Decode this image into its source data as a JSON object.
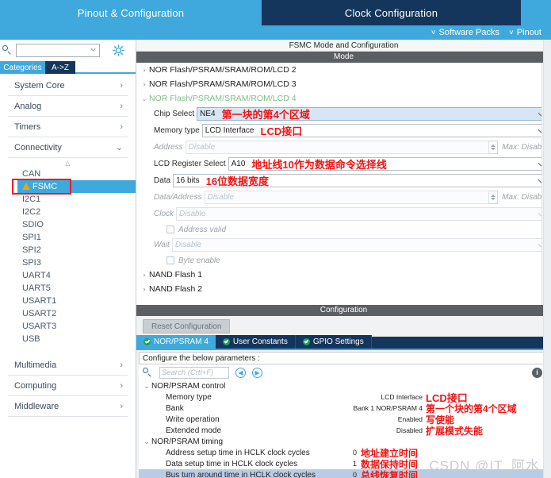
{
  "topbar": {
    "tabs": [
      {
        "label": "Pinout & Configuration",
        "state": "active"
      },
      {
        "label": "Clock Configuration",
        "state": "inactive"
      }
    ]
  },
  "secondbar": {
    "items": [
      {
        "label": "Software Packs",
        "icon": "chevron-down-icon"
      },
      {
        "label": "Pinout",
        "icon": "chevron-down-icon"
      }
    ]
  },
  "sidebar": {
    "search": {
      "value": "",
      "placeholder": ""
    },
    "gear_icon": "gear-icon",
    "tabs": [
      {
        "label": "Categories",
        "selected": true
      },
      {
        "label": "A->Z",
        "selected": false
      }
    ],
    "categories": [
      {
        "label": "System Core",
        "expanded": false
      },
      {
        "label": "Analog",
        "expanded": false
      },
      {
        "label": "Timers",
        "expanded": false
      },
      {
        "label": "Connectivity",
        "expanded": true
      }
    ],
    "peripherals": [
      {
        "label": "CAN",
        "selected": false,
        "warning": false
      },
      {
        "label": "FSMC",
        "selected": true,
        "warning": true
      },
      {
        "label": "I2C1",
        "selected": false,
        "warning": false
      },
      {
        "label": "I2C2",
        "selected": false,
        "warning": false
      },
      {
        "label": "SDIO",
        "selected": false,
        "warning": false
      },
      {
        "label": "SPI1",
        "selected": false,
        "warning": false
      },
      {
        "label": "SPI2",
        "selected": false,
        "warning": false
      },
      {
        "label": "SPI3",
        "selected": false,
        "warning": false
      },
      {
        "label": "UART4",
        "selected": false,
        "warning": false
      },
      {
        "label": "UART5",
        "selected": false,
        "warning": false
      },
      {
        "label": "USART1",
        "selected": false,
        "warning": false
      },
      {
        "label": "USART2",
        "selected": false,
        "warning": false
      },
      {
        "label": "USART3",
        "selected": false,
        "warning": false
      },
      {
        "label": "USB",
        "selected": false,
        "warning": false
      }
    ],
    "categories_bottom": [
      {
        "label": "Multimedia",
        "expanded": false
      },
      {
        "label": "Computing",
        "expanded": false
      },
      {
        "label": "Middleware",
        "expanded": false
      }
    ]
  },
  "right": {
    "panel_title": "FSMC Mode and Configuration",
    "mode_header": "Mode",
    "config_header": "Configuration",
    "mode_tree": [
      {
        "label": "NOR Flash/PSRAM/SRAM/ROM/LCD 2",
        "expanded": false
      },
      {
        "label": "NOR Flash/PSRAM/SRAM/ROM/LCD 3",
        "expanded": false
      },
      {
        "label": "NOR Flash/PSRAM/SRAM/ROM/LCD 4",
        "expanded": true
      }
    ],
    "mode_fields": [
      {
        "label": "Chip Select",
        "value": "NE4",
        "annotation": "第一块的第4个区域",
        "disabled": false,
        "selected": true,
        "kind": "dropdown"
      },
      {
        "label": "Memory type",
        "value": "LCD Interface",
        "annotation": "LCD接口",
        "disabled": false,
        "selected": false,
        "kind": "dropdown"
      },
      {
        "label": "Address",
        "value": "Disable",
        "annotation": "",
        "disabled": true,
        "selected": false,
        "kind": "spinner",
        "max_text": "Max: Disable"
      },
      {
        "label": "LCD Register Select",
        "value": "A10",
        "annotation": "地址线10作为数据命令选择线",
        "disabled": false,
        "selected": false,
        "kind": "dropdown"
      },
      {
        "label": "Data",
        "value": "16 bits",
        "annotation": "16位数据宽度",
        "disabled": false,
        "selected": false,
        "kind": "dropdown"
      },
      {
        "label": "Data/Address",
        "value": "Disable",
        "annotation": "",
        "disabled": true,
        "selected": false,
        "kind": "spinner",
        "max_text": "Max: Disable"
      },
      {
        "label": "Clock",
        "value": "Disable",
        "annotation": "",
        "disabled": true,
        "selected": false,
        "kind": "dropdown"
      }
    ],
    "checkbox_address_valid": {
      "label": "Address valid",
      "checked": false
    },
    "wait_field": {
      "label": "Wait",
      "value": "Disable",
      "disabled": true
    },
    "checkbox_byte_enable": {
      "label": "Byte enable",
      "checked": false
    },
    "nand_tree": [
      {
        "label": "NAND Flash 1",
        "expanded": false
      },
      {
        "label": "NAND Flash 2",
        "expanded": false
      }
    ],
    "reset_button": "Reset Configuration",
    "config_tabs": [
      {
        "label": "NOR/PSRAM 4",
        "selected": true
      },
      {
        "label": "User Constants",
        "selected": false
      },
      {
        "label": "GPIO Settings",
        "selected": false
      }
    ],
    "configure_hint": "Configure the below parameters :",
    "param_search": {
      "placeholder": "Search (Crtl+F)",
      "value": ""
    },
    "nav_prev_icon": "chevron-left-circle-icon",
    "nav_next_icon": "chevron-right-circle-icon",
    "info_icon": "info-icon",
    "param_groups": [
      {
        "name": "NOR/PSRAM control",
        "expanded": true,
        "rows": [
          {
            "name": "Memory type",
            "value": "LCD Interface",
            "annotation": "LCD接口"
          },
          {
            "name": "Bank",
            "value": "Bank 1 NOR/PSRAM 4",
            "annotation": "第一个块的第4个区域"
          },
          {
            "name": "Write operation",
            "value": "Enabled",
            "annotation": "写使能"
          },
          {
            "name": "Extended mode",
            "value": "Disabled",
            "annotation": "扩展模式失能"
          }
        ]
      },
      {
        "name": "NOR/PSRAM timing",
        "expanded": true,
        "rows": [
          {
            "name": "Address setup time in HCLK clock cycles",
            "value": "0",
            "annotation": "地址建立时间"
          },
          {
            "name": "Data setup time in HCLK clock cycles",
            "value": "1",
            "annotation": "数据保持时间"
          },
          {
            "name": "Bus turn around time in HCLK clock cycles",
            "value": "0",
            "annotation": "总线恢复时间",
            "highlighted": true
          }
        ]
      }
    ],
    "watermark": "CSDN @IT_阿水"
  },
  "colors": {
    "accent_blue": "#3fa9dd",
    "dark_navy": "#15365c",
    "annotation_red": "#f01414",
    "expanded_green": "#7ec08a",
    "highlight_row": "#b8cce4",
    "warning_amber": "#f0a30a",
    "red_box": "#ee1c25"
  }
}
